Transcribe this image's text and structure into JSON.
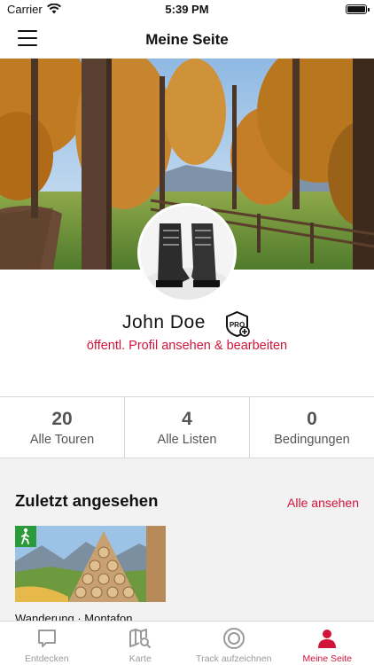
{
  "status_bar": {
    "carrier": "Carrier",
    "time": "5:39 PM"
  },
  "nav": {
    "title": "Meine Seite",
    "menu_icon": "hamburger-menu-icon"
  },
  "profile": {
    "name": "John  Doe",
    "badge_text": "PRO",
    "link_label": "öffentl. Profil ansehen & bearbeiten"
  },
  "stats": [
    {
      "value": "20",
      "label": "Alle Touren"
    },
    {
      "value": "4",
      "label": "Alle Listen"
    },
    {
      "value": "0",
      "label": "Bedingungen"
    }
  ],
  "recent": {
    "title": "Zuletzt angesehen",
    "view_all_label": "Alle ansehen",
    "items": [
      {
        "caption": "Wanderung · Montafon",
        "type_icon": "hiking-person-icon"
      }
    ]
  },
  "tabs": [
    {
      "label": "Entdecken",
      "icon": "speech-bubble-icon",
      "active": false
    },
    {
      "label": "Karte",
      "icon": "map-search-icon",
      "active": false
    },
    {
      "label": "Track aufzeichnen",
      "icon": "record-circle-icon",
      "active": false
    },
    {
      "label": "Meine Seite",
      "icon": "person-icon",
      "active": true
    }
  ],
  "colors": {
    "accent": "#d2143a",
    "tab_inactive": "#999999",
    "hiking_badge": "#2a9a3a",
    "section_bg": "#f2f2f2"
  }
}
